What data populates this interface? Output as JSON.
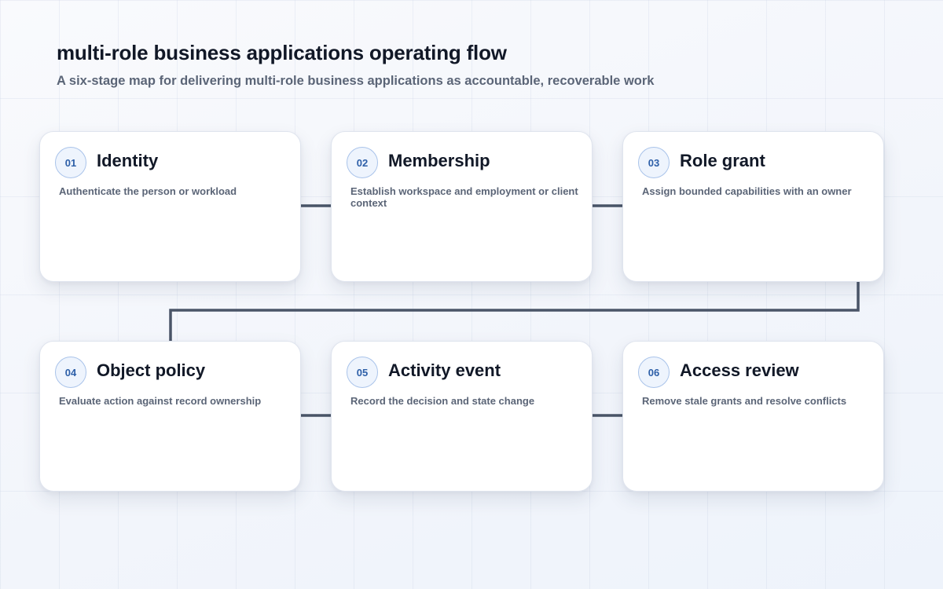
{
  "diagram": {
    "title": "multi-role business applications operating flow",
    "subtitle": "A six-stage map for delivering multi-role business applications as accountable, recoverable work",
    "stages": [
      {
        "number": "01",
        "title": "Identity",
        "description": "Authenticate the person or workload"
      },
      {
        "number": "02",
        "title": "Membership",
        "description": "Establish workspace and employment or client context"
      },
      {
        "number": "03",
        "title": "Role grant",
        "description": "Assign bounded capabilities with an owner"
      },
      {
        "number": "04",
        "title": "Object policy",
        "description": "Evaluate action against record ownership"
      },
      {
        "number": "05",
        "title": "Activity event",
        "description": "Record the decision and state change"
      },
      {
        "number": "06",
        "title": "Access review",
        "description": "Remove stale grants and resolve conflicts"
      }
    ],
    "colors": {
      "connector": "#4a5568",
      "badge_text": "#2d5fa8",
      "badge_border": "#a9c3ea",
      "card_bg": "#ffffff"
    }
  }
}
